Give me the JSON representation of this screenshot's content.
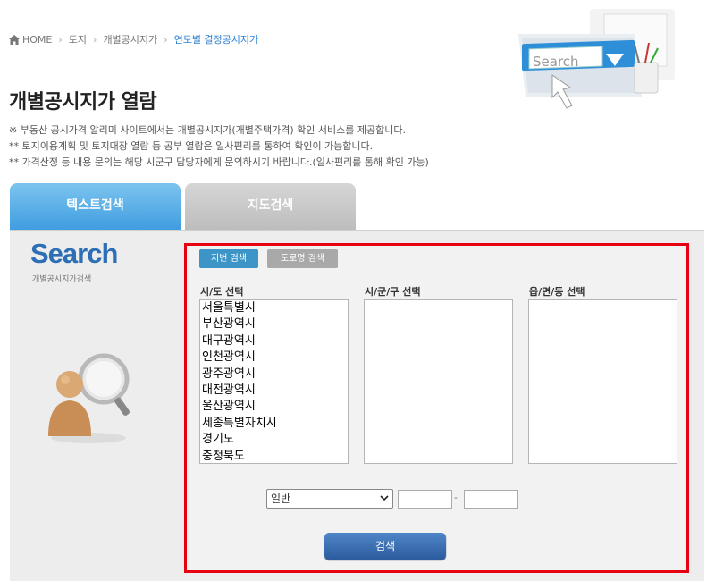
{
  "breadcrumb": {
    "home": "HOME",
    "items": [
      "토지",
      "개별공시지가"
    ],
    "current": "연도별 결정공시지가"
  },
  "page": {
    "title": "개별공시지가 열람",
    "notices": [
      "※ 부동산 공시가격 알리미 사이트에서는 개별공시지가(개별주택가격) 확인 서비스를 제공합니다.",
      "** 토지이용계획 및 토지대장 열람 등 공부 열람은 일사편리를 통하여 확인이 가능합니다.",
      "** 가격산정 등 내용 문의는 해당 시군구 담당자에게 문의하시기 바랍니다.(일사편리를 통해 확인 가능)"
    ]
  },
  "illustration": {
    "search_box_text": "Search"
  },
  "tabs": {
    "text_search": "텍스트검색",
    "map_search": "지도검색"
  },
  "panel": {
    "logo": "Search",
    "logo_sub": "개별공시지가검색",
    "lot_button": "지번 검색",
    "road_button": "도로명 검색",
    "sido_label": "시/도 선택",
    "sigungu_label": "시/군/구 선택",
    "eupmyeon_label": "읍/면/동 선택",
    "sido_options": [
      "서울특별시",
      "부산광역시",
      "대구광역시",
      "인천광역시",
      "광주광역시",
      "대전광역시",
      "울산광역시",
      "세종특별자치시",
      "경기도",
      "충청북도"
    ],
    "land_type": "일반",
    "dash": "-",
    "search_button": "검색"
  },
  "colors": {
    "accent_blue": "#3f9de0",
    "highlight_red": "#e60012",
    "title_blue": "#2d6fb5"
  }
}
